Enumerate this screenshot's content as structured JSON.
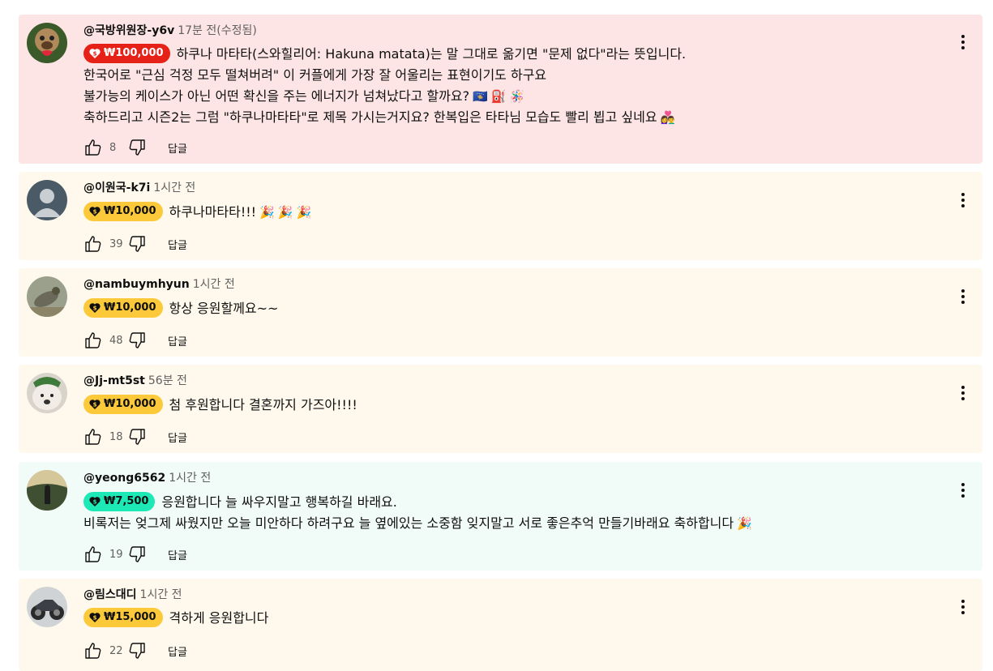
{
  "comments": [
    {
      "author": "@국방위원장-y6v",
      "time": "17분 전(수정됨)",
      "amount": "₩100,000",
      "chip_color": "#e62117",
      "lines": [
        "하쿠나 마타타(스와힐리어: Hakuna matata)는 말 그대로 옮기면  \"문제 없다\"라는 뜻입니다.",
        "한국어로 \"근심 걱정 모두 떨쳐버려\"  이 커플에게 가장 잘 어울리는 표현이기도 하구요",
        "불가능의 케이스가 아닌 어떤 확신을 주는 에너지가 넘쳐났다고 할까요?",
        " 축하드리고 시즌2는 그럼 \"하쿠나마타타\"로 제목 가시는거지요? 한복입은 타타님 모습도 빨리 뵙고 싶네요"
      ],
      "emojis": [
        "🇽🇰",
        "⛽",
        "🪅",
        "👩‍❤️‍👨"
      ],
      "likes": "8",
      "reply": "답글",
      "background": "#fde5e5"
    },
    {
      "author": "@이원국-k7i",
      "time": "1시간 전",
      "amount": "₩10,000",
      "chip_color": "#fcc93a",
      "lines": [
        "하쿠나마타타!!!"
      ],
      "emojis": [
        "🎉",
        "🎉",
        "🎉"
      ],
      "likes": "39",
      "reply": "답글",
      "background": "#fef9ec"
    },
    {
      "author": "@nambuymhyun",
      "time": "1시간 전",
      "amount": "₩10,000",
      "chip_color": "#fcc93a",
      "lines": [
        "항상 응원할께요~~"
      ],
      "likes": "48",
      "reply": "답글",
      "background": "#fef9ec"
    },
    {
      "author": "@Jj-mt5st",
      "time": "56분 전",
      "amount": "₩10,000",
      "chip_color": "#fcc93a",
      "lines": [
        "첨 후원합니다 결혼까지 가즈아!!!!"
      ],
      "likes": "18",
      "reply": "답글",
      "background": "#fef9ec"
    },
    {
      "author": "@yeong6562",
      "time": "1시간 전",
      "amount": "₩7,500",
      "chip_color": "#1de9b6",
      "lines": [
        "응원합니다 늘 싸우지말고 행복하길 바래요.",
        "비록저는 엊그제 싸웠지만 오늘 미안하다 하려구요 늘 옆에있는 소중함 잊지말고 서로 좋은추억 만들기바래요 축하합니다"
      ],
      "emojis": [
        "🎉"
      ],
      "likes": "19",
      "reply": "답글",
      "background": "#f1fbf8"
    },
    {
      "author": "@림스대디",
      "time": "1시간 전",
      "amount": "₩15,000",
      "chip_color": "#fcc93a",
      "lines": [
        "격하게 응원합니다"
      ],
      "likes": "22",
      "reply": "답글",
      "background": "#fef9ec"
    }
  ],
  "icons": {
    "like": "thumbs-up-icon",
    "dislike": "thumbs-down-icon",
    "more": "more-vert-icon",
    "heart_money": "heart-money-icon"
  }
}
